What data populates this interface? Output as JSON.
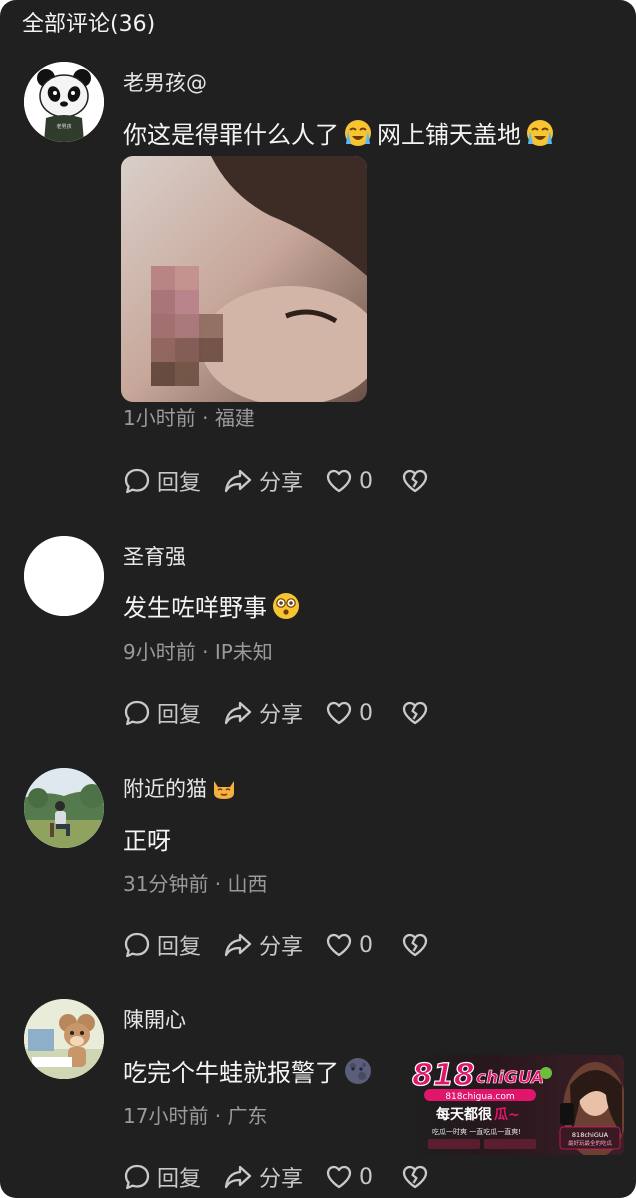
{
  "header": {
    "title": "全部评论(36)"
  },
  "actions": {
    "reply": "回复",
    "share": "分享"
  },
  "comments": [
    {
      "username": "老男孩@",
      "text_a": "你这是得罪什么人了",
      "text_b": "网上铺天盖地",
      "emoji": "crying-face-emoji",
      "time": "1小时前",
      "location": "福建",
      "likes": "0",
      "avatar_caption": "老男孩"
    },
    {
      "username": "圣育强",
      "text_a": "发生咗咩野事",
      "emoji": "hushed-face-emoji",
      "time": "9小时前",
      "location": "IP未知",
      "likes": "0"
    },
    {
      "username": "附近的猫",
      "text_a": "正呀",
      "emoji": "cat-face-emoji",
      "time": "31分钟前",
      "location": "山西",
      "likes": "0"
    },
    {
      "username": "陳開心",
      "text_a": "吃完个牛蛙就报警了",
      "emoji": "new-moon-face-emoji",
      "time": "17小时前",
      "location": "广东",
      "likes": "0"
    }
  ],
  "ad": {
    "logo_number": "818",
    "logo_text": "chiGUA",
    "url": "818chigua.com",
    "slogan_a": "每天都很",
    "slogan_b": "瓜~",
    "tagline": "吃瓜一时爽 一直吃瓜一直爽!",
    "badge_line1": "818chiGUA",
    "badge_line2": "最好玩最全的吃瓜"
  },
  "colors": {
    "background": "#202020",
    "text_primary": "#f4f4f4",
    "text_secondary": "#9a9a9a",
    "icon": "#c9c9c9",
    "ad_accent": "#e0156b"
  }
}
